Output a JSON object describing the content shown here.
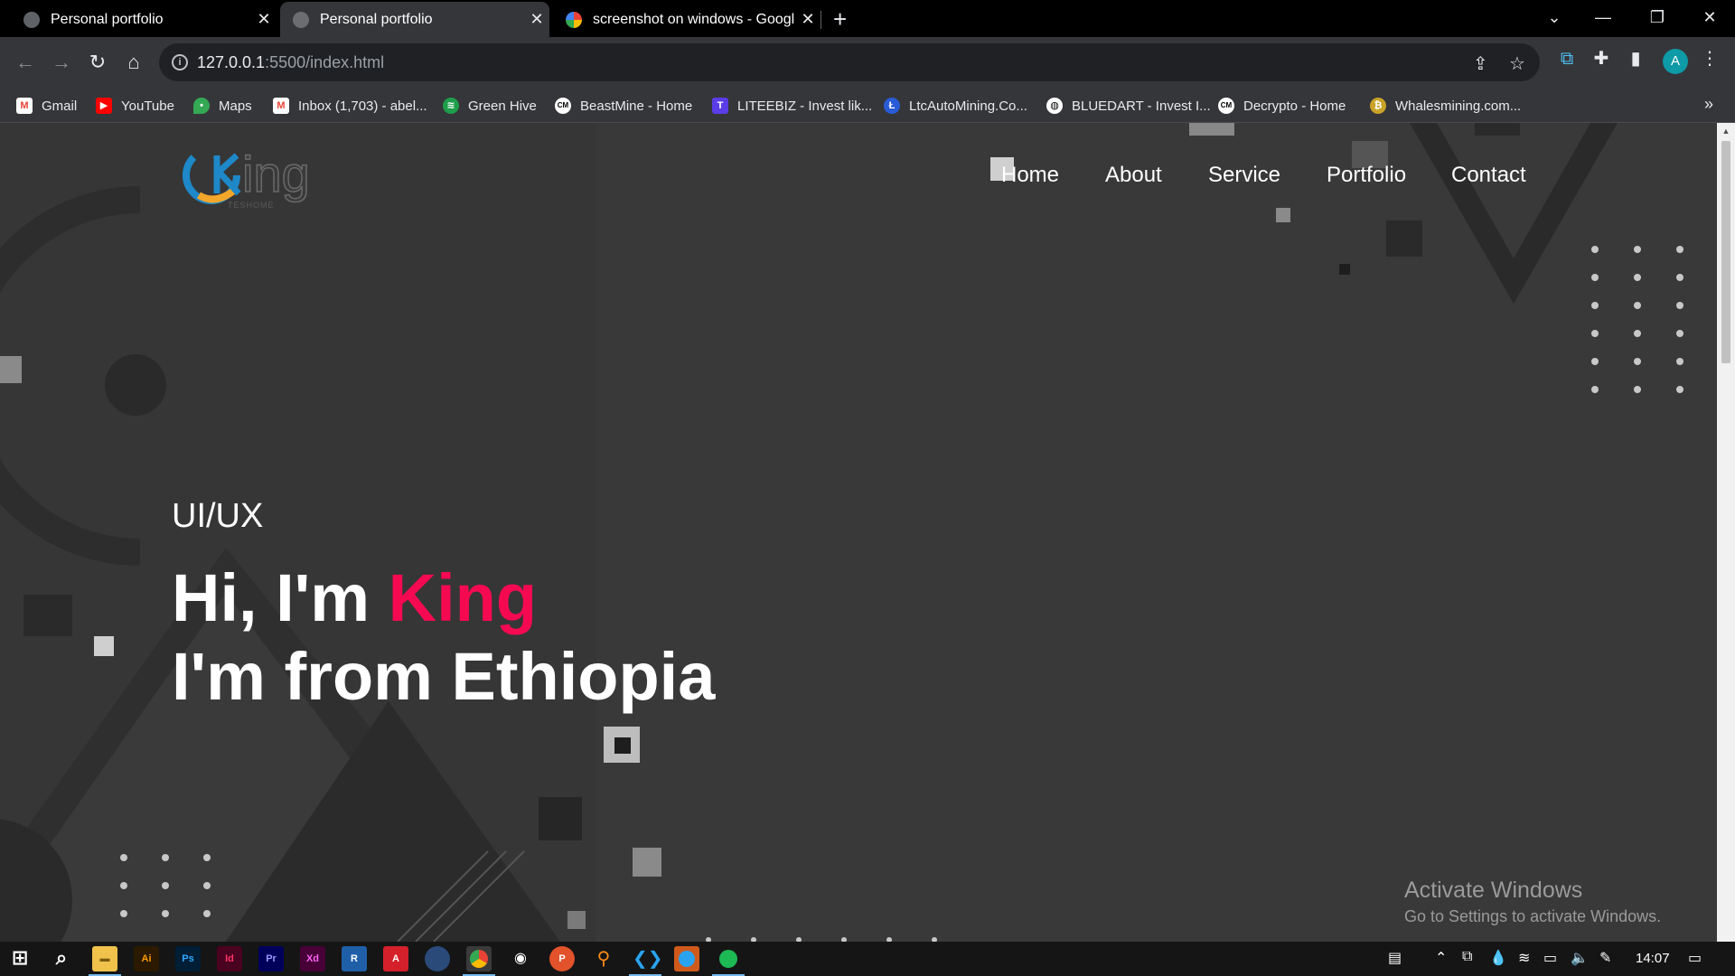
{
  "browser": {
    "tabs": [
      {
        "title": "Personal portfolio",
        "active": false
      },
      {
        "title": "Personal portfolio",
        "active": true
      },
      {
        "title": "screenshot on windows - Google",
        "active": false
      }
    ],
    "url_host": "127.0.0.1",
    "url_path": ":5500/index.html",
    "profile_initial": "A",
    "bookmarks": [
      {
        "label": "Gmail",
        "icon": "gmail-icon",
        "color": "#ea4335"
      },
      {
        "label": "YouTube",
        "icon": "youtube-icon",
        "color": "#ff0000"
      },
      {
        "label": "Maps",
        "icon": "maps-icon",
        "color": "#34a853"
      },
      {
        "label": "Inbox (1,703) - abel...",
        "icon": "gmail-icon",
        "color": "#ea4335"
      },
      {
        "label": "Green Hive",
        "icon": "greenhive-icon",
        "color": "#1e9e4a"
      },
      {
        "label": "BeastMine - Home",
        "icon": "cm-icon",
        "color": "#ffffff"
      },
      {
        "label": "LITEEBIZ - Invest lik...",
        "icon": "liteebiz-icon",
        "color": "#5a3de6"
      },
      {
        "label": "LtcAutoMining.Co...",
        "icon": "ltc-icon",
        "color": "#2a5bd7"
      },
      {
        "label": "BLUEDART - Invest I...",
        "icon": "globe-icon",
        "color": "#ffffff"
      },
      {
        "label": "Decrypto - Home",
        "icon": "cm-icon",
        "color": "#ffffff"
      },
      {
        "label": "Whalesmining.com...",
        "icon": "coin-icon",
        "color": "#c9a227"
      }
    ]
  },
  "site": {
    "logo_text": "ing",
    "logo_sub": "TESHOME",
    "nav": [
      "Home",
      "About",
      "Service",
      "Portfolio",
      "Contact"
    ],
    "hero_sub": "UI/UX",
    "hero_greeting": "Hi, I'm ",
    "hero_name": "King",
    "hero_line2": "I'm from Ethiopia",
    "accent_color": "#f50a52"
  },
  "watermark": {
    "title": "Activate Windows",
    "subtitle": "Go to Settings to activate Windows."
  },
  "taskbar": {
    "apps": [
      {
        "label": "Ai",
        "bg": "#2b1a00",
        "fg": "#ff9a00"
      },
      {
        "label": "Ps",
        "bg": "#001e36",
        "fg": "#31a8ff"
      },
      {
        "label": "Id",
        "bg": "#49021f",
        "fg": "#ff3366"
      },
      {
        "label": "Pr",
        "bg": "#00005b",
        "fg": "#9999ff"
      },
      {
        "label": "Xd",
        "bg": "#470137",
        "fg": "#ff61f6"
      },
      {
        "label": "R",
        "bg": "#1f5fa8",
        "fg": "#ffffff"
      },
      {
        "label": "A",
        "bg": "#d4202a",
        "fg": "#ffffff"
      }
    ],
    "time": "14:07"
  }
}
